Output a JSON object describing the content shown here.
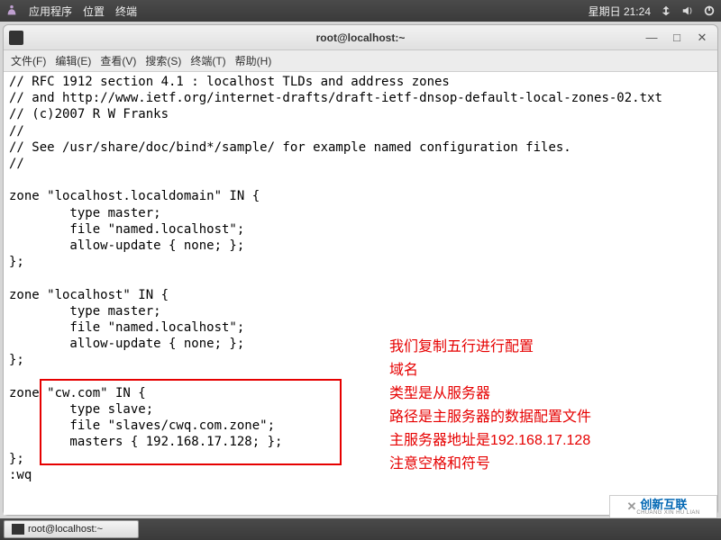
{
  "top_panel": {
    "menus": [
      "应用程序",
      "位置",
      "终端"
    ],
    "clock": "星期日 21:24"
  },
  "window": {
    "title": "root@localhost:~",
    "menus": [
      "文件(F)",
      "编辑(E)",
      "查看(V)",
      "搜索(S)",
      "终端(T)",
      "帮助(H)"
    ]
  },
  "terminal_lines": [
    "// RFC 1912 section 4.1 : localhost TLDs and address zones",
    "// and http://www.ietf.org/internet-drafts/draft-ietf-dnsop-default-local-zones-02.txt",
    "// (c)2007 R W Franks",
    "//",
    "// See /usr/share/doc/bind*/sample/ for example named configuration files.",
    "//",
    "",
    "zone \"localhost.localdomain\" IN {",
    "        type master;",
    "        file \"named.localhost\";",
    "        allow-update { none; };",
    "};",
    "",
    "zone \"localhost\" IN {",
    "        type master;",
    "        file \"named.localhost\";",
    "        allow-update { none; };",
    "};",
    "",
    "zone \"cw.com\" IN {",
    "        type slave;",
    "        file \"slaves/cwq.com.zone\";",
    "        masters { 192.168.17.128; };",
    "};",
    ":wq"
  ],
  "annotations": [
    "我们复制五行进行配置",
    "域名",
    "类型是从服务器",
    "路径是主服务器的数据配置文件",
    "主服务器地址是192.168.17.128",
    "注意空格和符号"
  ],
  "taskbar": {
    "item": "root@localhost:~"
  },
  "watermark": {
    "brand": "创新互联",
    "sub": "CHUANG XIN HU LIAN"
  }
}
